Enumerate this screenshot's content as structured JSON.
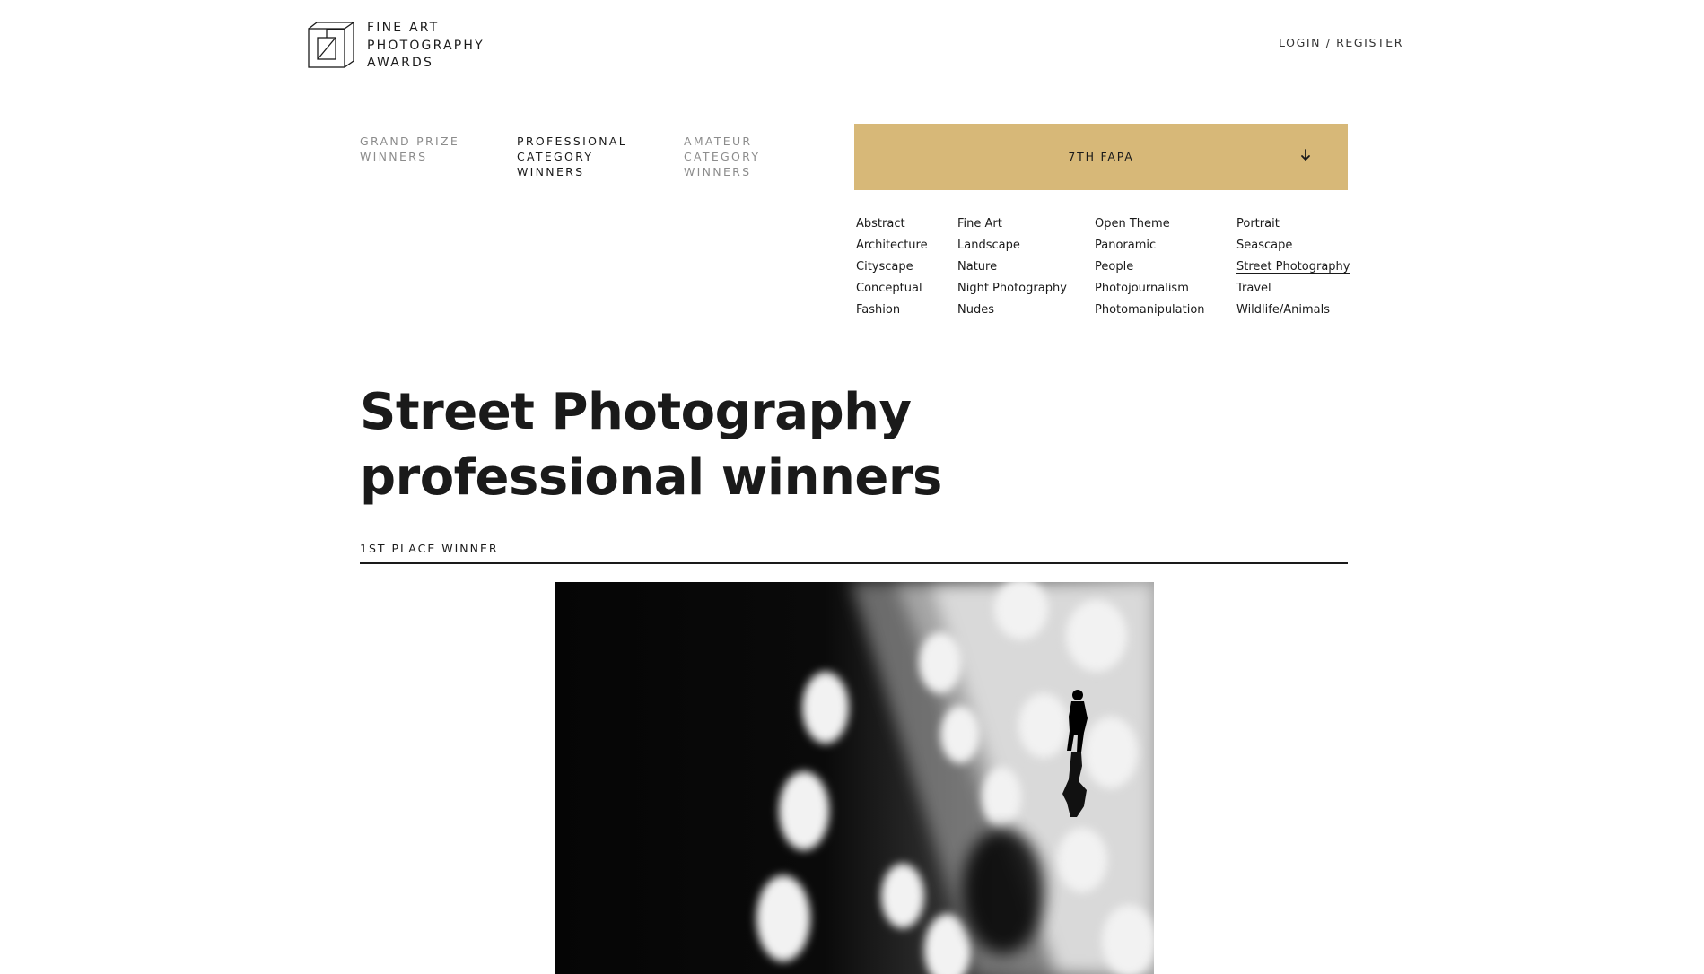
{
  "header": {
    "logo_lines": [
      "FINE ART",
      "PHOTOGRAPHY",
      "AWARDS"
    ],
    "login_label": "LOGIN / REGISTER"
  },
  "tabs": [
    {
      "lines": [
        "GRAND PRIZE",
        "WINNERS"
      ],
      "active": false
    },
    {
      "lines": [
        "PROFESSIONAL",
        "CATEGORY",
        "WINNERS"
      ],
      "active": true
    },
    {
      "lines": [
        "AMATEUR",
        "CATEGORY",
        "WINNERS"
      ],
      "active": false
    }
  ],
  "edition": {
    "label": "7TH FAPA",
    "icon": "arrow-down-icon"
  },
  "categories": {
    "col1": [
      "Abstract",
      "Architecture",
      "Cityscape",
      "Conceptual",
      "Fashion"
    ],
    "col2": [
      "Fine Art",
      "Landscape",
      "Nature",
      "Night Photography",
      "Nudes"
    ],
    "col3": [
      "Open Theme",
      "Panoramic",
      "People",
      "Photojournalism",
      "Photomanipulation"
    ],
    "col4": [
      "Portrait",
      "Seascape",
      "Street Photography",
      "Travel",
      "Wildlife/Animals"
    ],
    "active": "Street Photography"
  },
  "main": {
    "title_lines": [
      "Street Photography",
      "professional winners"
    ],
    "place_label": "1ST PLACE WINNER"
  },
  "colors": {
    "accent": "#d7b878",
    "text": "#1a1a1a",
    "muted": "#8c8c8c"
  }
}
